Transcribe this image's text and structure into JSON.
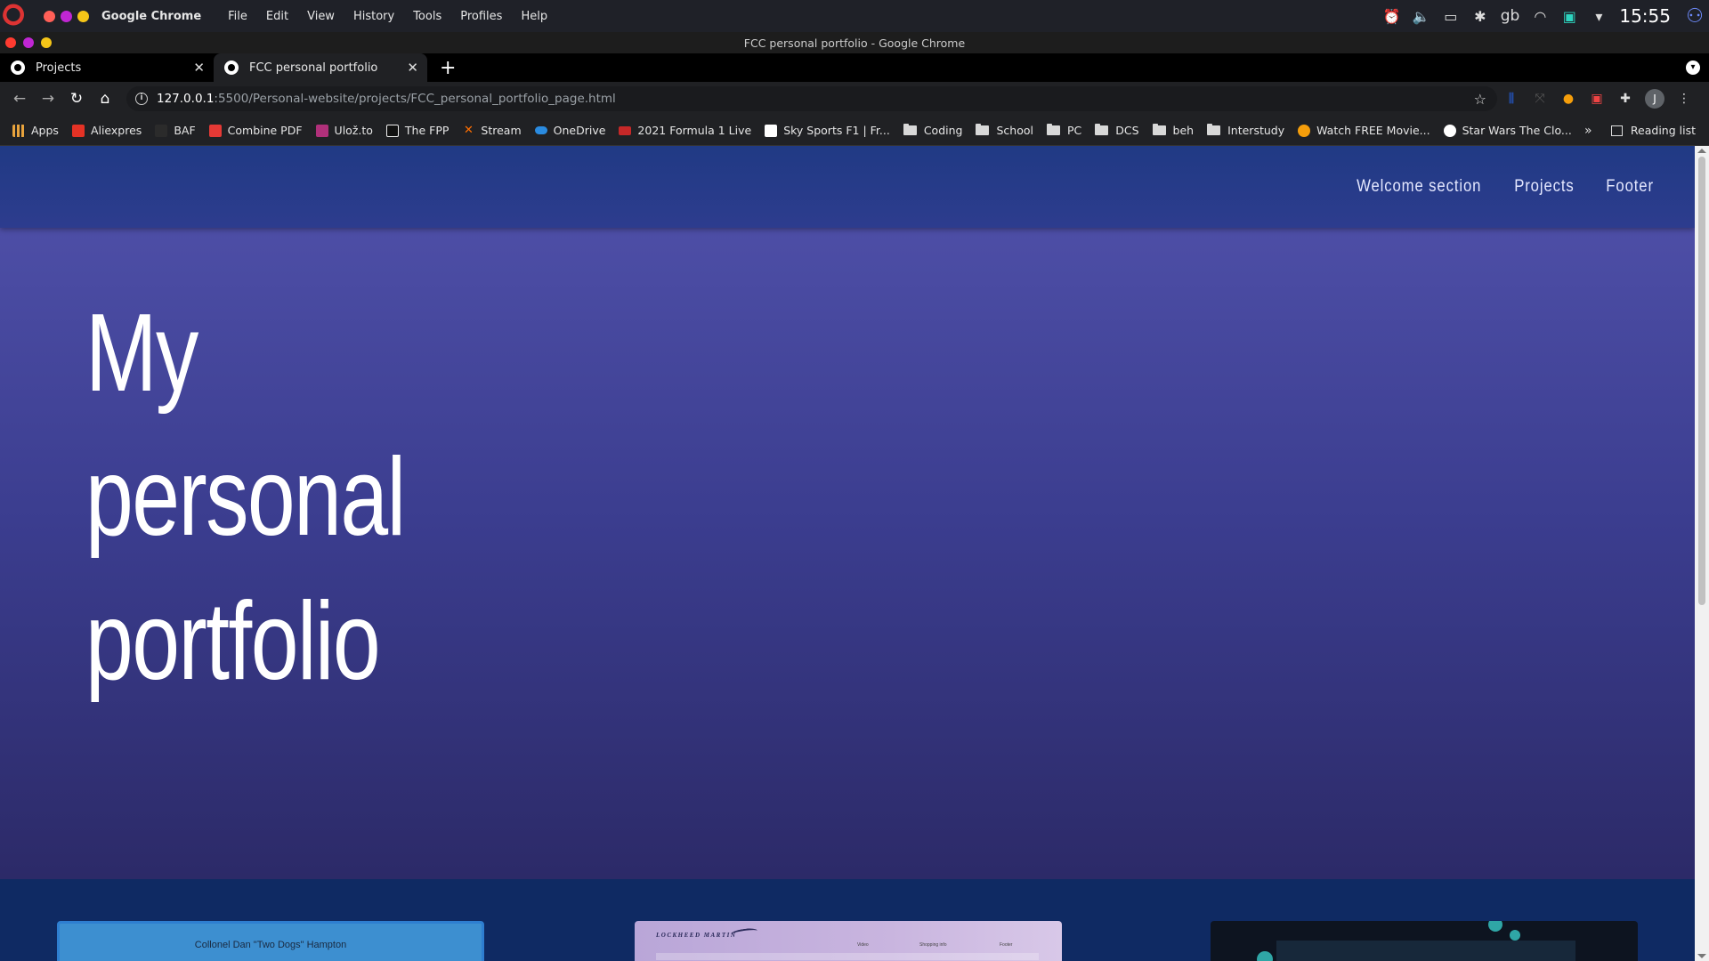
{
  "os": {
    "app_name": "Google Chrome",
    "menu": [
      "File",
      "Edit",
      "View",
      "History",
      "Tools",
      "Profiles",
      "Help"
    ],
    "tray": {
      "keyboard_layout": "gb",
      "clock": "15:55"
    },
    "dot_colors": [
      "#ff5f57",
      "#c026d3",
      "#f5c518"
    ]
  },
  "window": {
    "title": "FCC personal portfolio - Google Chrome"
  },
  "tabs": [
    {
      "label": "Projects",
      "active": false
    },
    {
      "label": "FCC personal portfolio",
      "active": true
    }
  ],
  "toolbar": {
    "url_host": "127.0.0.1",
    "url_rest": ":5500/Personal-website/projects/FCC_personal_portfolio_page.html",
    "profile_initial": "J"
  },
  "bookmarks": [
    {
      "label": "Apps",
      "icon": "apps-grid-icon",
      "color": "#e8a33d"
    },
    {
      "label": "Aliexpres",
      "icon": "aliexpress-icon",
      "color": "#e43225"
    },
    {
      "label": "BAF",
      "icon": "baf-icon",
      "color": "#2b2b2b"
    },
    {
      "label": "Combine PDF",
      "icon": "pdf-icon",
      "color": "#e53935"
    },
    {
      "label": "Ulož.to",
      "icon": "ulozto-icon",
      "color": "#b0307a"
    },
    {
      "label": "The FPP",
      "icon": "fpp-icon",
      "color": "#111111"
    },
    {
      "label": "Stream",
      "icon": "stream-icon",
      "color": "#ff6f00"
    },
    {
      "label": "OneDrive",
      "icon": "onedrive-icon",
      "color": "#2a8be0"
    },
    {
      "label": "2021 Formula 1 Live",
      "icon": "f1-icon",
      "color": "#c62828"
    },
    {
      "label": "Sky Sports F1 | Fr...",
      "icon": "sky-icon",
      "color": "#ffffff"
    },
    {
      "label": "Coding",
      "icon": "folder-icon"
    },
    {
      "label": "School",
      "icon": "folder-icon"
    },
    {
      "label": "PC",
      "icon": "folder-icon"
    },
    {
      "label": "DCS",
      "icon": "folder-icon"
    },
    {
      "label": "beh",
      "icon": "folder-icon"
    },
    {
      "label": "Interstudy",
      "icon": "folder-icon"
    },
    {
      "label": "Watch FREE Movie...",
      "icon": "movie-icon",
      "color": "#f59e0b"
    },
    {
      "label": "Star Wars The Clo...",
      "icon": "globe-icon",
      "color": "#ffffff"
    }
  ],
  "reading_list": "Reading list",
  "site": {
    "nav": [
      "Welcome section",
      "Projects",
      "Footer"
    ],
    "headline": "My personal portfolio",
    "colors": {
      "nav": "#203a84",
      "welcome_top": "#4d4ea6",
      "welcome_bottom": "#2c2a68",
      "projects_bg": "#0f2a63"
    },
    "projects": [
      {
        "caption": "Collonel Dan \"Two Dogs\" Hampton"
      },
      {
        "logo": "LOCKHEED MARTIN",
        "nav": [
          "Video",
          "Shopping info",
          "Footer"
        ]
      },
      {
        "caption": ""
      }
    ]
  }
}
